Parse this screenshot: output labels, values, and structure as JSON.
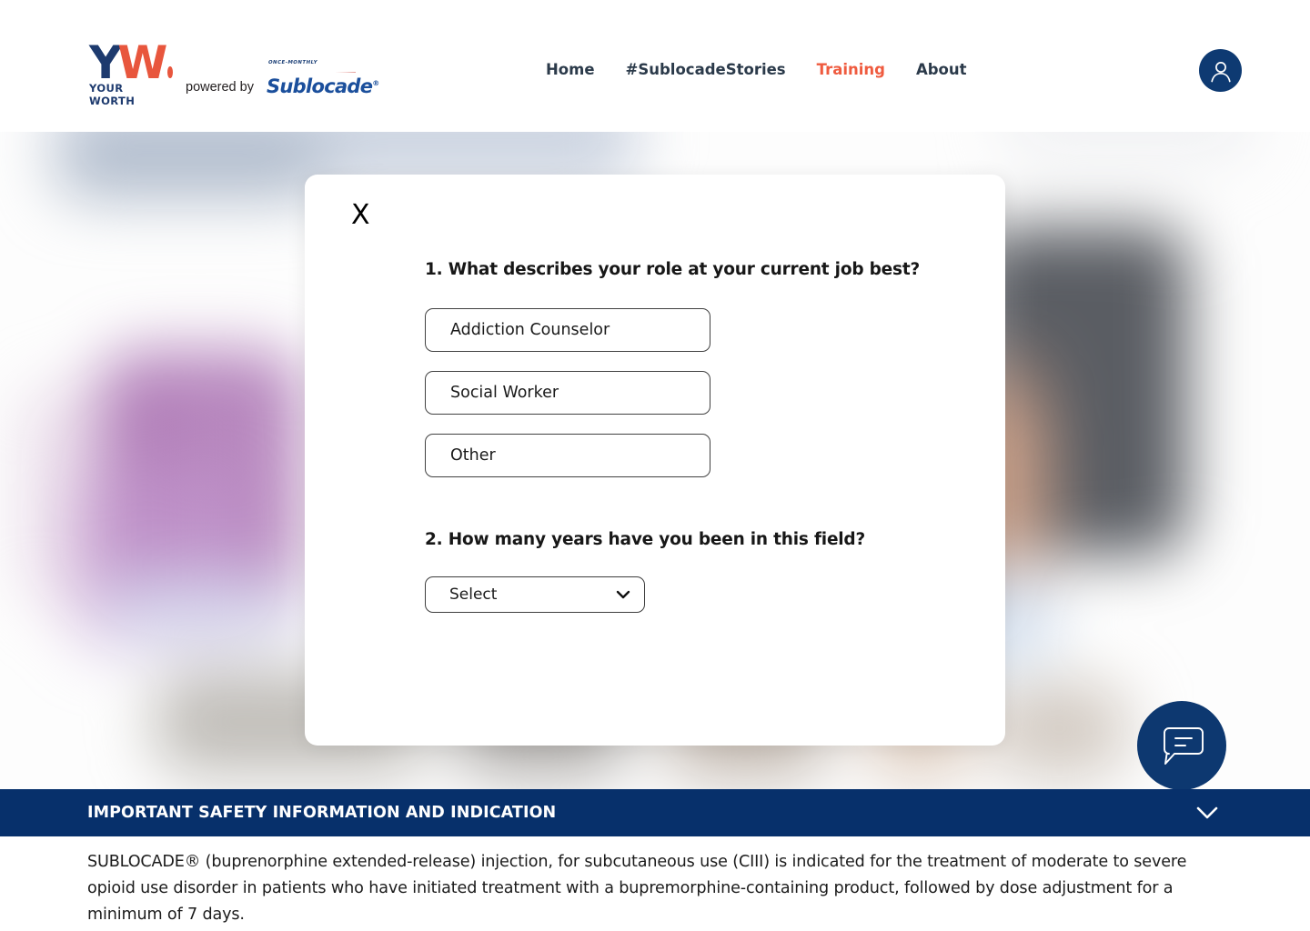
{
  "header": {
    "logo": {
      "yw_y": "Y",
      "yw_w": "W",
      "yw_tagline": "YOUR WORTH",
      "powered_by": "powered by",
      "sublocade_once_monthly": "ONCE-MONTHLY",
      "sublocade_word": "Sublocade",
      "sublocade_reg": "®"
    },
    "nav": [
      {
        "label": "Home",
        "active": false
      },
      {
        "label": "#SublocadeStories",
        "active": false
      },
      {
        "label": "Training",
        "active": true
      },
      {
        "label": "About",
        "active": false
      }
    ],
    "account_icon": "user-account-icon"
  },
  "modal": {
    "close_label": "X",
    "questions": [
      {
        "number": "1.",
        "text": "What describes your role at your current job best?",
        "full": "1.  What describes your role at your current job best?",
        "options": [
          "Addiction Counselor",
          "Social Worker",
          "Other"
        ]
      },
      {
        "number": "2.",
        "text": "How many years have you been in this field?",
        "full": "2. How many years have you been in this field?",
        "select_value": "Select",
        "select_icon": "chevron-down-icon"
      }
    ]
  },
  "chat": {
    "icon": "chat-bubble-icon",
    "label": "Chat"
  },
  "isi": {
    "heading": "IMPORTANT SAFETY INFORMATION AND INDICATION",
    "toggle_icon": "chevron-down-icon",
    "body": "SUBLOCADE® (buprenorphine extended-release) injection, for subcutaneous use (CIII) is indicated for the treatment of moderate to severe opioid use disorder in patients who have initiated treatment with a bupremorphine-containing product, followed by dose adjustment for a minimum of 7 days."
  },
  "colors": {
    "brand_navy": "#1d3a6e",
    "brand_orange": "#e8563d",
    "nav_active": "#ef5b3f",
    "isi_navy": "#07306b",
    "chat_navy": "#0d3870"
  }
}
